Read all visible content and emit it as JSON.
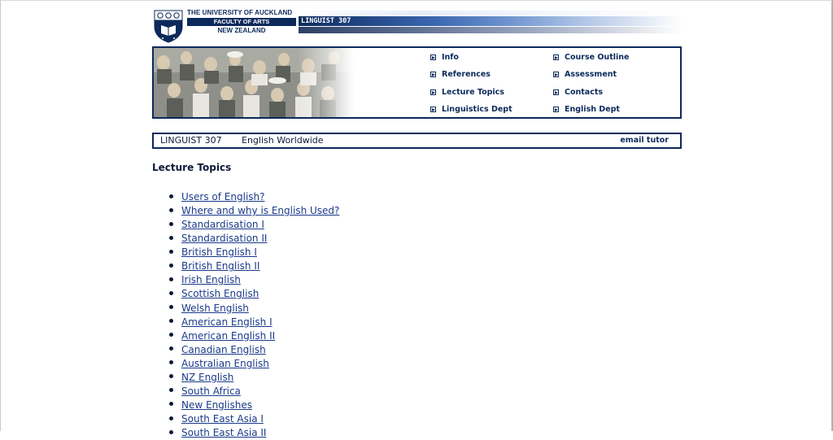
{
  "header": {
    "university": "THE UNIVERSITY OF AUCKLAND",
    "faculty": "FACULTY OF ARTS",
    "country": "NEW ZEALAND",
    "course_banner": "LINGUIST 307"
  },
  "nav": {
    "left": [
      "Info",
      "References",
      "Lecture Topics",
      "Linguistics Dept"
    ],
    "right": [
      "Course Outline",
      "Assessment",
      "Contacts",
      "English Dept"
    ]
  },
  "title_bar": {
    "course_code": "LINGUIST 307",
    "course_name": "English Worldwide",
    "email_link": "email tutor"
  },
  "main": {
    "heading": "Lecture Topics",
    "topics": [
      "Users of English?",
      "Where and why is English Used?",
      "Standardisation I",
      "Standardisation II",
      "British English I",
      "British English II",
      "Irish English",
      "Scottish English",
      "Welsh English",
      "American English I",
      "American English II",
      "Canadian English",
      "Australian English",
      "NZ English",
      "South Africa",
      "New Englishes",
      "South East Asia I",
      "South East Asia II"
    ]
  },
  "colors": {
    "brand_navy": "#0b2a5b",
    "link_blue": "#1a3a8a"
  }
}
